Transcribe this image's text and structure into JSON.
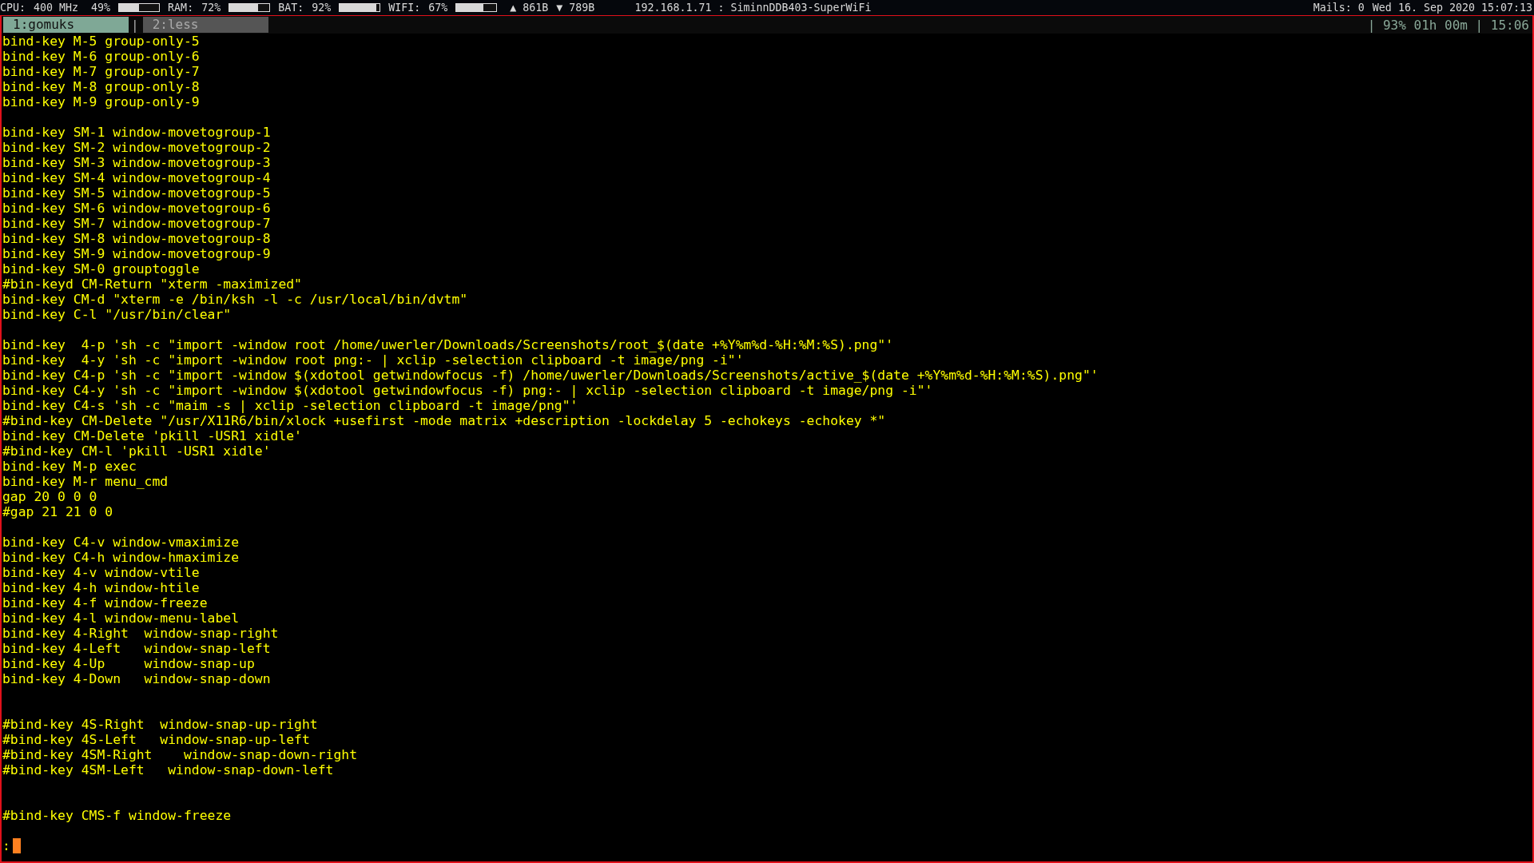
{
  "status_bar": {
    "meters": [
      {
        "label": "CPU:",
        "reading": "400 MHz  49%",
        "level": 0.49
      },
      {
        "label": "RAM:",
        "reading": "72%",
        "level": 0.72
      },
      {
        "label": "BAT:",
        "reading": "92%",
        "level": 0.92
      },
      {
        "label": "WIFI:",
        "reading": "67%",
        "level": 0.67
      }
    ],
    "upload": "▲ 861B",
    "download": "▼ 789B",
    "network": "192.168.1.71 : SiminnDDB403-SuperWiFi",
    "mails": "Mails: 0",
    "datetime": "Wed 16. Sep 2020 15:07:13"
  },
  "tabs": [
    {
      "label": "1:gomuks",
      "selected": true
    },
    {
      "label": "2:less",
      "selected": false
    }
  ],
  "tab_separator": "|",
  "tab_status": "| 93% 01h 00m | 15:06",
  "lines": [
    {
      "kind": "text",
      "text": "bind-key M-5 group-only-5"
    },
    {
      "kind": "text",
      "text": "bind-key M-6 group-only-6"
    },
    {
      "kind": "text",
      "text": "bind-key M-7 group-only-7"
    },
    {
      "kind": "text",
      "text": "bind-key M-8 group-only-8"
    },
    {
      "kind": "text",
      "text": "bind-key M-9 group-only-9"
    },
    {
      "kind": "blank"
    },
    {
      "kind": "text",
      "text": "bind-key SM-1 window-movetogroup-1"
    },
    {
      "kind": "text",
      "text": "bind-key SM-2 window-movetogroup-2"
    },
    {
      "kind": "text",
      "text": "bind-key SM-3 window-movetogroup-3"
    },
    {
      "kind": "text",
      "text": "bind-key SM-4 window-movetogroup-4"
    },
    {
      "kind": "text",
      "text": "bind-key SM-5 window-movetogroup-5"
    },
    {
      "kind": "text",
      "text": "bind-key SM-6 window-movetogroup-6"
    },
    {
      "kind": "text",
      "text": "bind-key SM-7 window-movetogroup-7"
    },
    {
      "kind": "text",
      "text": "bind-key SM-8 window-movetogroup-8"
    },
    {
      "kind": "text",
      "text": "bind-key SM-9 window-movetogroup-9"
    },
    {
      "kind": "text",
      "text": "bind-key SM-0 grouptoggle"
    },
    {
      "kind": "text",
      "text": "#bin-keyd CM-Return \"xterm -maximized\""
    },
    {
      "kind": "text",
      "text": "bind-key CM-d \"xterm -e /bin/ksh -l -c /usr/local/bin/dvtm\""
    },
    {
      "kind": "text",
      "text": "bind-key C-l \"/usr/bin/clear\""
    },
    {
      "kind": "blank"
    },
    {
      "kind": "text",
      "text": "bind-key  4-p 'sh -c \"import -window root /home/uwerler/Downloads/Screenshots/root_$(date +%Y%m%d-%H:%M:%S).png\"'"
    },
    {
      "kind": "text",
      "text": "bind-key  4-y 'sh -c \"import -window root png:- | xclip -selection clipboard -t image/png -i\"'"
    },
    {
      "kind": "text",
      "text": "bind-key C4-p 'sh -c \"import -window $(xdotool getwindowfocus -f) /home/uwerler/Downloads/Screenshots/active_$(date +%Y%m%d-%H:%M:%S).png\"'"
    },
    {
      "kind": "text",
      "text": "bind-key C4-y 'sh -c \"import -window $(xdotool getwindowfocus -f) png:- | xclip -selection clipboard -t image/png -i\"'"
    },
    {
      "kind": "text",
      "text": "bind-key C4-s 'sh -c \"maim -s | xclip -selection clipboard -t image/png\"'"
    },
    {
      "kind": "text",
      "text": "#bind-key CM-Delete \"/usr/X11R6/bin/xlock +usefirst -mode matrix +description -lockdelay 5 -echokeys -echokey *\""
    },
    {
      "kind": "text",
      "text": "bind-key CM-Delete 'pkill -USR1 xidle'"
    },
    {
      "kind": "text",
      "text": "#bind-key CM-l 'pkill -USR1 xidle'"
    },
    {
      "kind": "text",
      "text": "bind-key M-p exec"
    },
    {
      "kind": "text",
      "text": "bind-key M-r menu_cmd"
    },
    {
      "kind": "text",
      "text": "gap 20 0 0 0"
    },
    {
      "kind": "text",
      "text": "#gap 21 21 0 0"
    },
    {
      "kind": "blank"
    },
    {
      "kind": "text",
      "text": "bind-key C4-v window-vmaximize"
    },
    {
      "kind": "text",
      "text": "bind-key C4-h window-hmaximize"
    },
    {
      "kind": "text",
      "text": "bind-key 4-v window-vtile"
    },
    {
      "kind": "text",
      "text": "bind-key 4-h window-htile"
    },
    {
      "kind": "text",
      "text": "bind-key 4-f window-freeze"
    },
    {
      "kind": "text",
      "text": "bind-key 4-l window-menu-label"
    },
    {
      "kind": "text",
      "text": "bind-key 4-Right  window-snap-right"
    },
    {
      "kind": "text",
      "text": "bind-key 4-Left   window-snap-left"
    },
    {
      "kind": "text",
      "text": "bind-key 4-Up     window-snap-up"
    },
    {
      "kind": "text",
      "text": "bind-key 4-Down   window-snap-down"
    },
    {
      "kind": "blank"
    },
    {
      "kind": "blank"
    },
    {
      "kind": "text",
      "text": "#bind-key 4S-Right  window-snap-up-right"
    },
    {
      "kind": "text",
      "text": "#bind-key 4S-Left   window-snap-up-left"
    },
    {
      "kind": "text",
      "text": "#bind-key 4SM-Right    window-snap-down-right"
    },
    {
      "kind": "text",
      "text": "#bind-key 4SM-Left   window-snap-down-left"
    },
    {
      "kind": "blank"
    },
    {
      "kind": "blank"
    },
    {
      "kind": "text",
      "text": "#bind-key CMS-f window-freeze"
    },
    {
      "kind": "blank"
    }
  ],
  "prompt": ":"
}
